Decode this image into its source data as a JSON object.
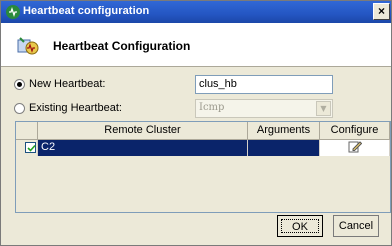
{
  "window": {
    "title": "Heartbeat configuration",
    "close_glyph": "×"
  },
  "header": {
    "title": "Heartbeat Configuration",
    "icon": "heartbeat-config-icon"
  },
  "new_heartbeat": {
    "label": "New Heartbeat:",
    "value": "clus_hb",
    "selected": true
  },
  "existing_heartbeat": {
    "label": "Existing Heartbeat:",
    "value": "Icmp",
    "selected": false,
    "enabled": false
  },
  "table": {
    "columns": [
      "Remote Cluster",
      "Arguments",
      "Configure"
    ],
    "rows": [
      {
        "checked": true,
        "remote_cluster": "C2",
        "arguments": "",
        "configure_icon": "edit-pencil-icon"
      }
    ]
  },
  "buttons": {
    "ok": "OK",
    "cancel": "Cancel"
  },
  "colors": {
    "titlebar": "#2456c3",
    "selection": "#0a246a",
    "dialog_bg": "#ece9d8"
  }
}
